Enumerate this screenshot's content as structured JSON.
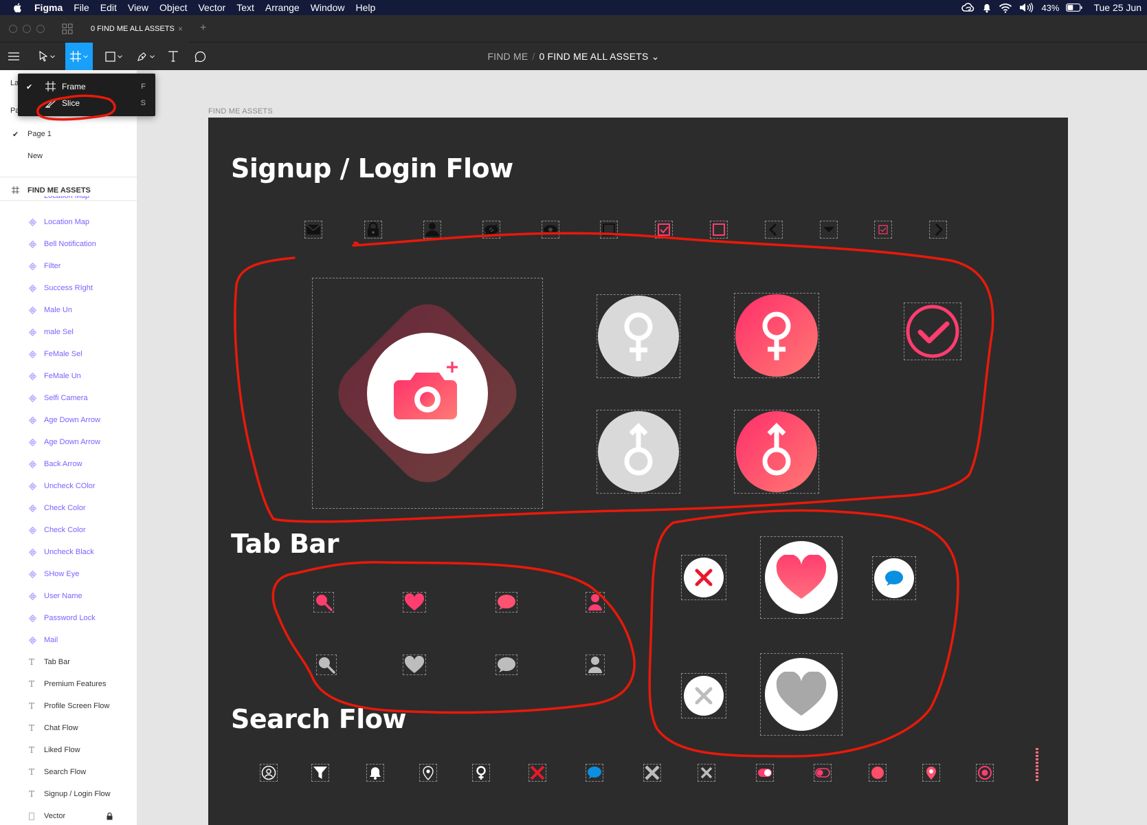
{
  "menubar": {
    "app": "Figma",
    "items": [
      "File",
      "Edit",
      "View",
      "Object",
      "Vector",
      "Text",
      "Arrange",
      "Window",
      "Help"
    ],
    "battery": "43%",
    "datetime": "Tue 25 Jun"
  },
  "tabs": {
    "active": "0 FIND ME ALL ASSETS",
    "close": "×",
    "add": "+"
  },
  "breadcrumb": {
    "project": "FIND ME",
    "separator": "/",
    "file": "0 FIND ME ALL ASSETS ⌄"
  },
  "dropdown": {
    "items": [
      {
        "label": "Frame",
        "key": "F",
        "checked": true
      },
      {
        "label": "Slice",
        "key": "S",
        "checked": false
      }
    ]
  },
  "sidebar": {
    "tab_stub": "La",
    "pages_stub": "Pa",
    "pages": [
      "Page 1",
      "New"
    ],
    "frame": "FIND ME ASSETS",
    "cut_layer": "Location Map",
    "layers": [
      {
        "label": "Location Map",
        "type": "component"
      },
      {
        "label": "Bell Notification",
        "type": "component"
      },
      {
        "label": "Filter",
        "type": "component"
      },
      {
        "label": "Success RIght",
        "type": "component"
      },
      {
        "label": "Male Un",
        "type": "component"
      },
      {
        "label": "male Sel",
        "type": "component"
      },
      {
        "label": "FeMale Sel",
        "type": "component"
      },
      {
        "label": "FeMale Un",
        "type": "component"
      },
      {
        "label": "Selfi Camera",
        "type": "component"
      },
      {
        "label": "Age Down Arrow",
        "type": "component"
      },
      {
        "label": "Age Down Arrow",
        "type": "component"
      },
      {
        "label": "Back Arrow",
        "type": "component"
      },
      {
        "label": "Uncheck COlor",
        "type": "component"
      },
      {
        "label": "Check Color",
        "type": "component"
      },
      {
        "label": "Check Color",
        "type": "component"
      },
      {
        "label": "Uncheck Black",
        "type": "component"
      },
      {
        "label": "SHow Eye",
        "type": "component"
      },
      {
        "label": "User Name",
        "type": "component"
      },
      {
        "label": "Password Lock",
        "type": "component"
      },
      {
        "label": "Mail",
        "type": "component"
      },
      {
        "label": "Tab Bar",
        "type": "text"
      },
      {
        "label": "Premium Features",
        "type": "text"
      },
      {
        "label": "Profile Screen Flow",
        "type": "text"
      },
      {
        "label": "Chat Flow",
        "type": "text"
      },
      {
        "label": "Liked Flow",
        "type": "text"
      },
      {
        "label": "Search Flow",
        "type": "text"
      },
      {
        "label": "Signup / Login Flow",
        "type": "text"
      },
      {
        "label": "Vector",
        "type": "vector"
      }
    ]
  },
  "canvas": {
    "frame_label": "FIND ME ASSETS",
    "sections": {
      "signup": "Signup / Login Flow",
      "tabbar": "Tab Bar",
      "search": "Search Flow"
    }
  },
  "colors": {
    "accent": "#18a0fb",
    "pink": "#ff3d6e",
    "pink_light": "#ff6f7d",
    "component": "#7b61ff",
    "annotation": "#e8190a",
    "artboard": "#2c2c2c"
  },
  "icons": {
    "signup_row": [
      "mail-icon",
      "lock-icon",
      "user-icon",
      "hide-eye-icon",
      "show-eye-icon",
      "uncheck-black-icon",
      "check-color-icon",
      "uncheck-color-icon",
      "back-arrow-icon",
      "age-down-arrow-icon",
      "small-check-icon",
      "forward-arrow-icon"
    ],
    "search_row": [
      "user-outline-icon",
      "filter-icon",
      "bell-icon",
      "location-pin-icon",
      "female-small-icon",
      "cross-red-icon",
      "chat-blue-icon",
      "cross-gray-icon",
      "cross-small-icon",
      "toggle-on-icon",
      "toggle-off-icon",
      "gradient-dot-icon",
      "location-pink-icon",
      "target-icon",
      "slider-track-icon"
    ]
  }
}
